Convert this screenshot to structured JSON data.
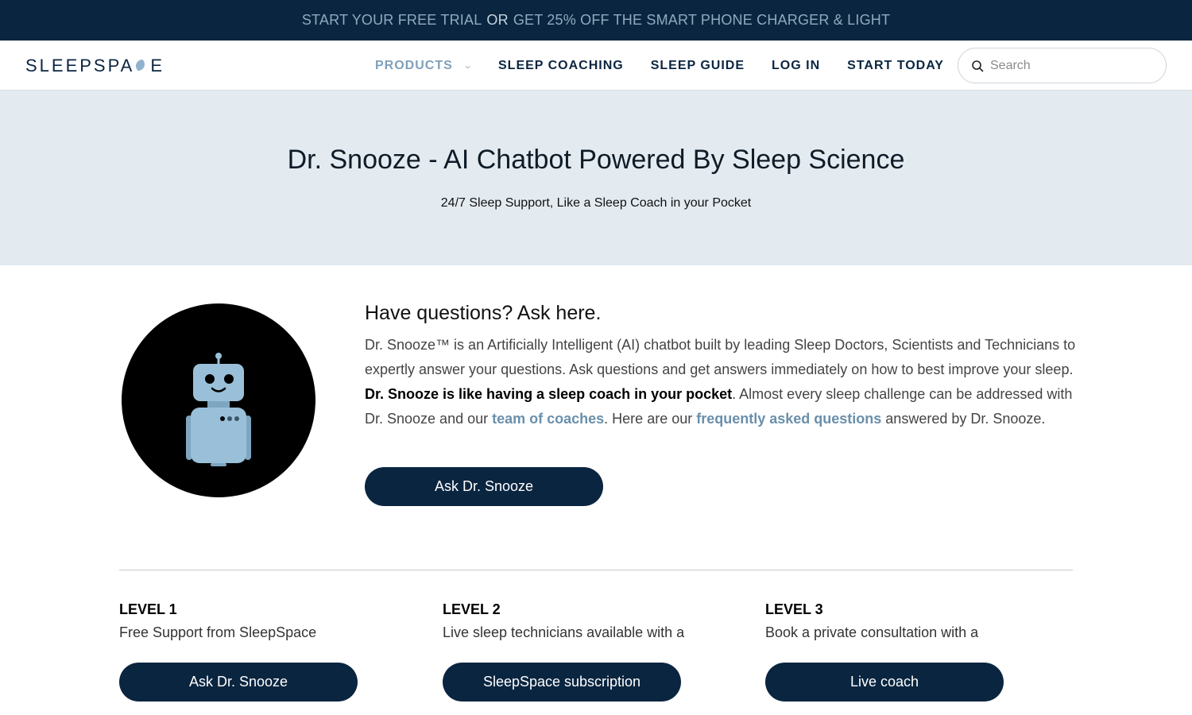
{
  "promo": {
    "part1": "START YOUR FREE TRIAL",
    "or": "OR",
    "part2": "GET 25% OFF THE SMART PHONE CHARGER & LIGHT"
  },
  "nav": {
    "logo_left": "SLEEPSPA",
    "logo_right": "E",
    "links": [
      "PRODUCTS",
      "SLEEP COACHING",
      "SLEEP GUIDE",
      "LOG IN",
      "START TODAY"
    ],
    "search_placeholder": "Search"
  },
  "hero": {
    "title": "Dr. Snooze - AI Chatbot Powered By Sleep Science",
    "subtitle": "24/7 Sleep Support, Like a Sleep Coach in your Pocket"
  },
  "intro": {
    "heading": "Have questions? Ask here.",
    "text1": "Dr. Snooze™ is an Artificially Intelligent (AI) chatbot built by leading Sleep Doctors, Scientists and Technicians to expertly answer your questions. Ask questions and get answers immediately on how to best improve your sleep. ",
    "bold": "Dr. Snooze is like having a sleep coach in your pocket",
    "text2": ". Almost every sleep challenge can be addressed with Dr. Snooze and our ",
    "link1": "team of coaches",
    "text3": ". Here are our ",
    "link2": "frequently asked questions",
    "text4": " answered by Dr. Snooze.",
    "button": "Ask Dr. Snooze"
  },
  "levels": [
    {
      "title": "LEVEL 1",
      "desc": "Free Support from SleepSpace",
      "button": "Ask Dr. Snooze"
    },
    {
      "title": "LEVEL 2",
      "desc": "Live sleep technicians available with a",
      "button": "SleepSpace subscription"
    },
    {
      "title": "LEVEL 3",
      "desc": "Book a private consultation with a",
      "button": "Live coach"
    }
  ],
  "colors": {
    "navy": "#0a2540",
    "hero_bg": "#e3ebf1",
    "link_blue": "#6a8fab",
    "robot_blue": "#9ac0d9"
  }
}
